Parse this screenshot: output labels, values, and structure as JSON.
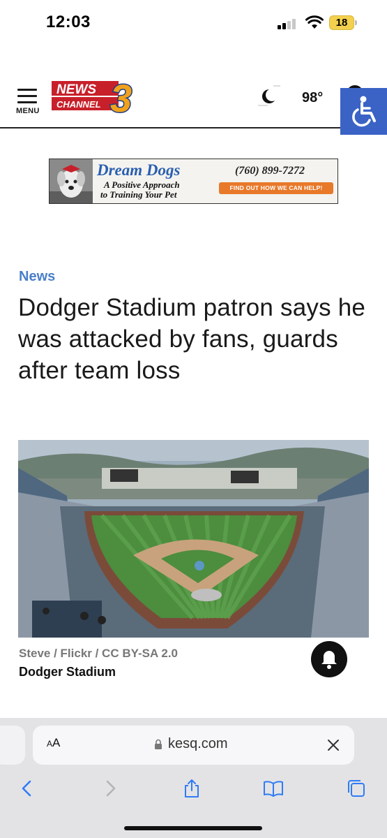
{
  "status_bar": {
    "time": "12:03",
    "battery": "18",
    "icons": [
      "signal-icon",
      "wifi-icon",
      "battery-icon"
    ]
  },
  "header": {
    "menu_label": "MENU",
    "logo": {
      "line1": "NEWS",
      "line2": "CHANNEL",
      "number": "3"
    },
    "weather_icon": "moon-icon",
    "temperature": "98°",
    "accessibility_icon": "wheelchair-icon",
    "colors": {
      "accent": "#3a63c5",
      "logo_red": "#c8202a",
      "logo_gold": "#f0a21c"
    }
  },
  "ad": {
    "title": "Dream Dogs",
    "phone": "(760) 899-7272",
    "tagline_1": "A Positive Approach",
    "tagline_2": "to Training Your Pet",
    "cta": "FIND OUT HOW WE CAN HELP!"
  },
  "article": {
    "category": "News",
    "headline": "Dodger Stadium patron says he was attacked by fans, guards after team loss",
    "image_credit": "Steve / Flickr / CC BY-SA 2.0",
    "image_caption": "Dodger Stadium",
    "notification_icon": "bell-icon"
  },
  "browser": {
    "aa_label_small": "A",
    "aa_label_large": "A",
    "url": "kesq.com",
    "toolbar": [
      "back-icon",
      "forward-icon",
      "share-icon",
      "bookmarks-icon",
      "tabs-icon"
    ],
    "accent": "#2f7cf6"
  }
}
